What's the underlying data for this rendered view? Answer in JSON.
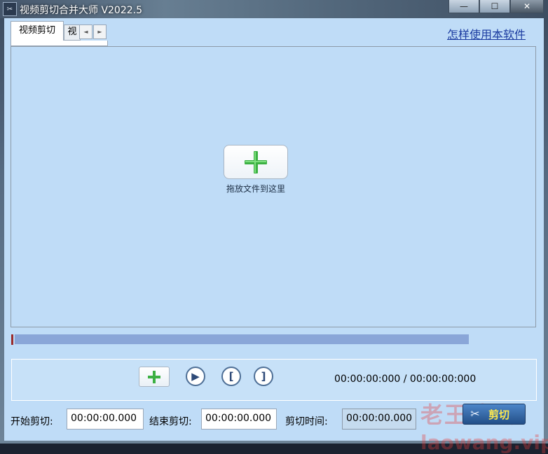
{
  "window": {
    "title": "视频剪切合并大师 V2022.5",
    "minimize": "—",
    "maximize": "☐",
    "close": "✕"
  },
  "tabs": {
    "active": "视频剪切",
    "next": "视",
    "scroll_left": "◄",
    "scroll_right": "►"
  },
  "help": {
    "link": "怎样使用本软件"
  },
  "drop": {
    "label": "拖放文件到这里",
    "icon": "green-plus-icon"
  },
  "player": {
    "time_display": "00:00:00:000 / 00:00:00:000",
    "play_icon": "▶",
    "mark_in_icon": "[",
    "mark_out_icon": "]"
  },
  "cut": {
    "start_label": "开始剪切:",
    "start_value": "00:00:00.000",
    "end_label": "结束剪切:",
    "end_value": "00:00:00.000",
    "duration_label": "剪切时间:",
    "duration_value": "00:00:00.000",
    "button_label": "剪切"
  },
  "watermark": {
    "main": "老王论坛",
    "sub": "laowang.vip"
  },
  "colors": {
    "accent_green": "#3cb043",
    "timeline": "#8aa6d8",
    "link": "#1a3aa0"
  }
}
